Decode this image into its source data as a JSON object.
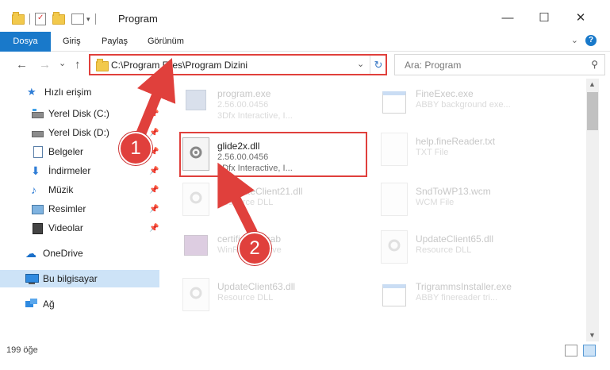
{
  "window": {
    "title": "Program",
    "minimize": "—",
    "maximize": "☐",
    "close": "✕"
  },
  "ribbon": {
    "tabs": [
      "Dosya",
      "Giriş",
      "Paylaş",
      "Görünüm"
    ],
    "help": "?"
  },
  "navigation": {
    "back": "←",
    "forward": "→",
    "recent": "⌄",
    "up": "↑",
    "address": "C:\\Program Files\\Program Dizini",
    "search_placeholder": "Ara: Program"
  },
  "sidebar": {
    "items": [
      {
        "label": "Hızlı erişim",
        "icon": "star-icon",
        "pinned": false
      },
      {
        "label": "Yerel Disk (C:)",
        "icon": "drive-icon",
        "pinned": true
      },
      {
        "label": "Yerel Disk (D:)",
        "icon": "drive-icon",
        "pinned": true
      },
      {
        "label": "Belgeler",
        "icon": "documents-icon",
        "pinned": true
      },
      {
        "label": "İndirmeler",
        "icon": "download-icon",
        "pinned": true
      },
      {
        "label": "Müzik",
        "icon": "music-icon",
        "pinned": true
      },
      {
        "label": "Resimler",
        "icon": "pictures-icon",
        "pinned": true
      },
      {
        "label": "Videolar",
        "icon": "videos-icon",
        "pinned": true
      },
      {
        "label": "OneDrive",
        "icon": "cloud-icon",
        "pinned": false
      },
      {
        "label": "Bu bilgisayar",
        "icon": "computer-icon",
        "pinned": false,
        "selected": true
      },
      {
        "label": "Ağ",
        "icon": "network-icon",
        "pinned": false
      }
    ]
  },
  "files": [
    {
      "name": "program.exe",
      "line2": "2.56.00.0456",
      "line3": "3Dfx Interactive, I...",
      "icon": "executable-icon"
    },
    {
      "name": "FineExec.exe",
      "line2": "ABBY background exe...",
      "line3": "",
      "icon": "application-window-icon"
    },
    {
      "name": "glide2x.dll",
      "line2": "2.56.00.0456",
      "line3": "3Dfx Interactive, I...",
      "icon": "dll-gear-icon"
    },
    {
      "name": "help.fineReader.txt",
      "line2": "TXT File",
      "line3": "",
      "icon": "text-file-icon"
    },
    {
      "name": "QUpdateClient21.dll",
      "line2": "Resource DLL",
      "line3": "",
      "icon": "dll-gear-icon"
    },
    {
      "name": "SndToWP13.wcm",
      "line2": "WCM File",
      "line3": "",
      "icon": "blank-file-icon"
    },
    {
      "name": "certificates.cab",
      "line2": "WinRAR archive",
      "line3": "",
      "icon": "archive-icon"
    },
    {
      "name": "UpdateClient65.dll",
      "line2": "Resource DLL",
      "line3": "",
      "icon": "dll-gear-icon"
    },
    {
      "name": "UpdateClient63.dll",
      "line2": "Resource DLL",
      "line3": "",
      "icon": "dll-gear-icon"
    },
    {
      "name": "TrigrammsInstaller.exe",
      "line2": "ABBY finereader tri...",
      "line3": "",
      "icon": "application-window-icon"
    }
  ],
  "status": {
    "item_count": "199 öğe"
  },
  "annotations": {
    "step1": "1",
    "step2": "2",
    "color": "#e0403c"
  }
}
